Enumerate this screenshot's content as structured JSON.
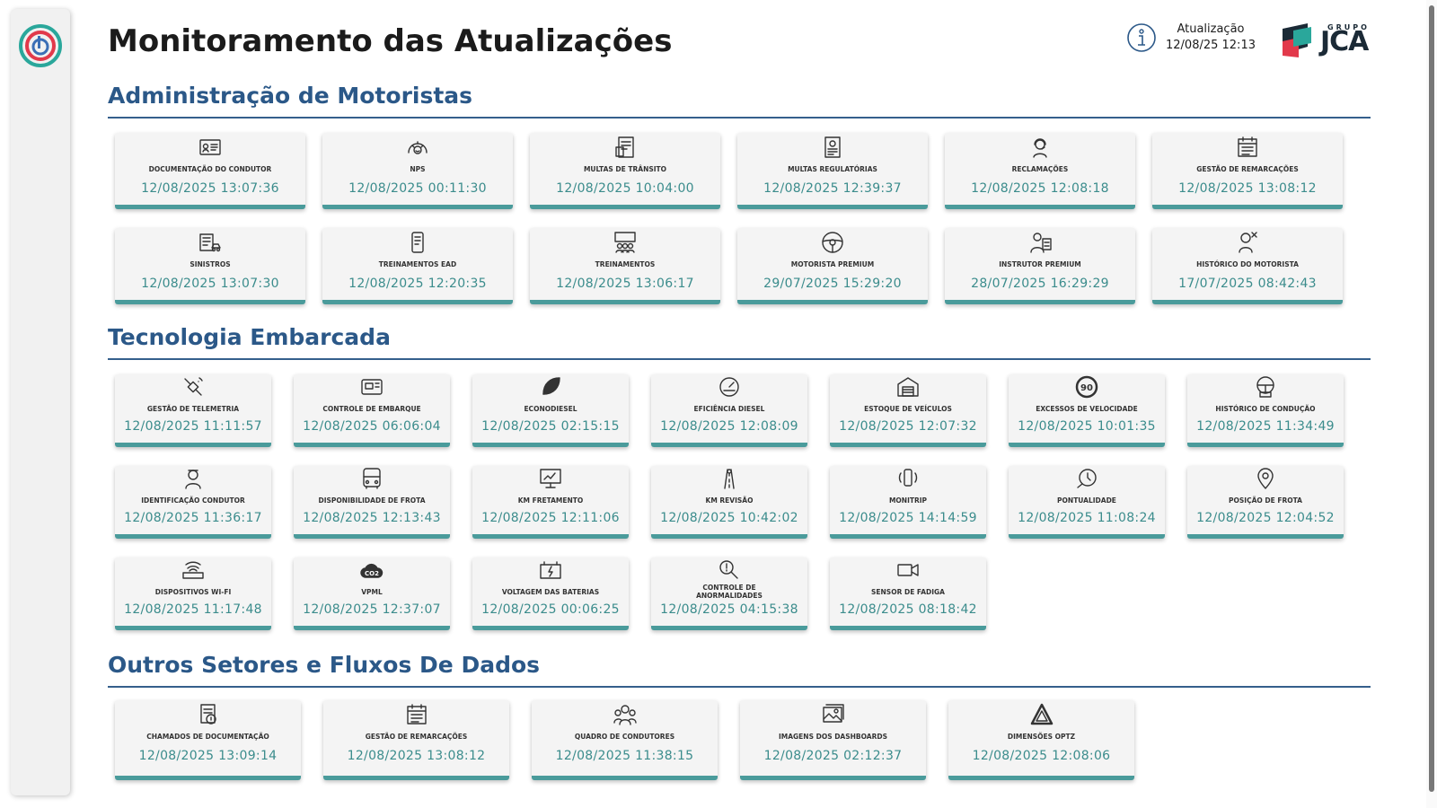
{
  "header": {
    "title": "Monitoramento das Atualizações",
    "update_label": "Atualização",
    "update_value": "12/08/25 12:13",
    "company_grupo": "GRUPO",
    "company_name": "JCA"
  },
  "colors": {
    "accent": "#4a9b9b",
    "section_title": "#2b5888",
    "card_bg": "#f4f4f4",
    "time_text": "#3b8c8c"
  },
  "sections": [
    {
      "title": "Administração de Motoristas",
      "cards": [
        {
          "label": "Documentação do Condutor",
          "time": "12/08/2025 13:07:36",
          "icon": "id-card-icon"
        },
        {
          "label": "NPS",
          "time": "12/08/2025 00:11:30",
          "icon": "gauge-smile-icon"
        },
        {
          "label": "Multas de Trânsito",
          "time": "12/08/2025 10:04:00",
          "icon": "ticket-document-icon"
        },
        {
          "label": "Multas Regulatórias",
          "time": "12/08/2025 12:39:37",
          "icon": "regulation-document-icon"
        },
        {
          "label": "Reclamações",
          "time": "12/08/2025 12:08:18",
          "icon": "support-agent-icon"
        },
        {
          "label": "Gestão de Remarcações",
          "time": "12/08/2025 13:08:12",
          "icon": "calendar-list-icon"
        },
        {
          "label": "Sinistros",
          "time": "12/08/2025 13:07:30",
          "icon": "accident-report-icon"
        },
        {
          "label": "Treinamentos EAD",
          "time": "12/08/2025 12:20:35",
          "icon": "mobile-learning-icon"
        },
        {
          "label": "Treinamentos",
          "time": "12/08/2025 13:06:17",
          "icon": "classroom-icon"
        },
        {
          "label": "Motorista Premium",
          "time": "29/07/2025 15:29:20",
          "icon": "steering-wheel-icon"
        },
        {
          "label": "Instrutor Premium",
          "time": "28/07/2025 16:29:29",
          "icon": "instructor-icon"
        },
        {
          "label": "Histórico do Motorista",
          "time": "17/07/2025 08:42:43",
          "icon": "driver-history-icon"
        }
      ]
    },
    {
      "title": "Tecnologia Embarcada",
      "cards": [
        {
          "label": "Gestão de Telemetria",
          "time": "12/08/2025 11:11:57",
          "icon": "satellite-icon"
        },
        {
          "label": "Controle de Embarque",
          "time": "12/08/2025 06:06:04",
          "icon": "bus-board-icon"
        },
        {
          "label": "Econodiesel",
          "time": "12/08/2025 02:15:15",
          "icon": "leaf-icon"
        },
        {
          "label": "Eficiência Diesel",
          "time": "12/08/2025 12:08:09",
          "icon": "fuel-gauge-icon"
        },
        {
          "label": "Estoque de Veículos",
          "time": "12/08/2025 12:07:32",
          "icon": "garage-icon"
        },
        {
          "label": "Excessos de Velocidade",
          "time": "12/08/2025 10:01:35",
          "icon": "speed-limit-icon"
        },
        {
          "label": "Histórico de Condução",
          "time": "12/08/2025 11:34:49",
          "icon": "driving-history-icon"
        },
        {
          "label": "Identificação Condutor",
          "time": "12/08/2025 11:36:17",
          "icon": "driver-id-icon"
        },
        {
          "label": "Disponibilidade de Frota",
          "time": "12/08/2025 12:13:43",
          "icon": "bus-icon"
        },
        {
          "label": "KM Fretamento",
          "time": "12/08/2025 12:11:06",
          "icon": "monitor-chart-icon"
        },
        {
          "label": "KM Revisão",
          "time": "12/08/2025 10:42:02",
          "icon": "road-icon"
        },
        {
          "label": "Monitrip",
          "time": "12/08/2025 14:14:59",
          "icon": "phone-signal-icon"
        },
        {
          "label": "Pontualidade",
          "time": "12/08/2025 11:08:24",
          "icon": "clock-icon"
        },
        {
          "label": "Posição de Frota",
          "time": "12/08/2025 12:04:52",
          "icon": "map-pin-icon"
        },
        {
          "label": "Dispositivos Wi-Fi",
          "time": "12/08/2025 11:17:48",
          "icon": "wifi-router-icon"
        },
        {
          "label": "VPML",
          "time": "12/08/2025 12:37:07",
          "icon": "co2-cloud-icon"
        },
        {
          "label": "Voltagem das Baterias",
          "time": "12/08/2025 00:06:25",
          "icon": "battery-icon"
        },
        {
          "label": "Controle de Anormalidades",
          "time": "12/08/2025 04:15:38",
          "icon": "magnifier-alert-icon"
        },
        {
          "label": "Sensor de Fadiga",
          "time": "12/08/2025 08:18:42",
          "icon": "camera-icon"
        }
      ]
    },
    {
      "title": "Outros Setores e Fluxos De Dados",
      "cards": [
        {
          "label": "Chamados de Documentação",
          "time": "12/08/2025 13:09:14",
          "icon": "document-ticket-icon"
        },
        {
          "label": "Gestão de Remarcações",
          "time": "12/08/2025 13:08:12",
          "icon": "calendar-list-icon"
        },
        {
          "label": "Quadro de Condutores",
          "time": "12/08/2025 11:38:15",
          "icon": "team-icon"
        },
        {
          "label": "Imagens dos Dashboards",
          "time": "12/08/2025 02:12:37",
          "icon": "image-gallery-icon"
        },
        {
          "label": "Dimensões Optz",
          "time": "12/08/2025 12:08:06",
          "icon": "optz-logo-icon"
        }
      ]
    }
  ]
}
